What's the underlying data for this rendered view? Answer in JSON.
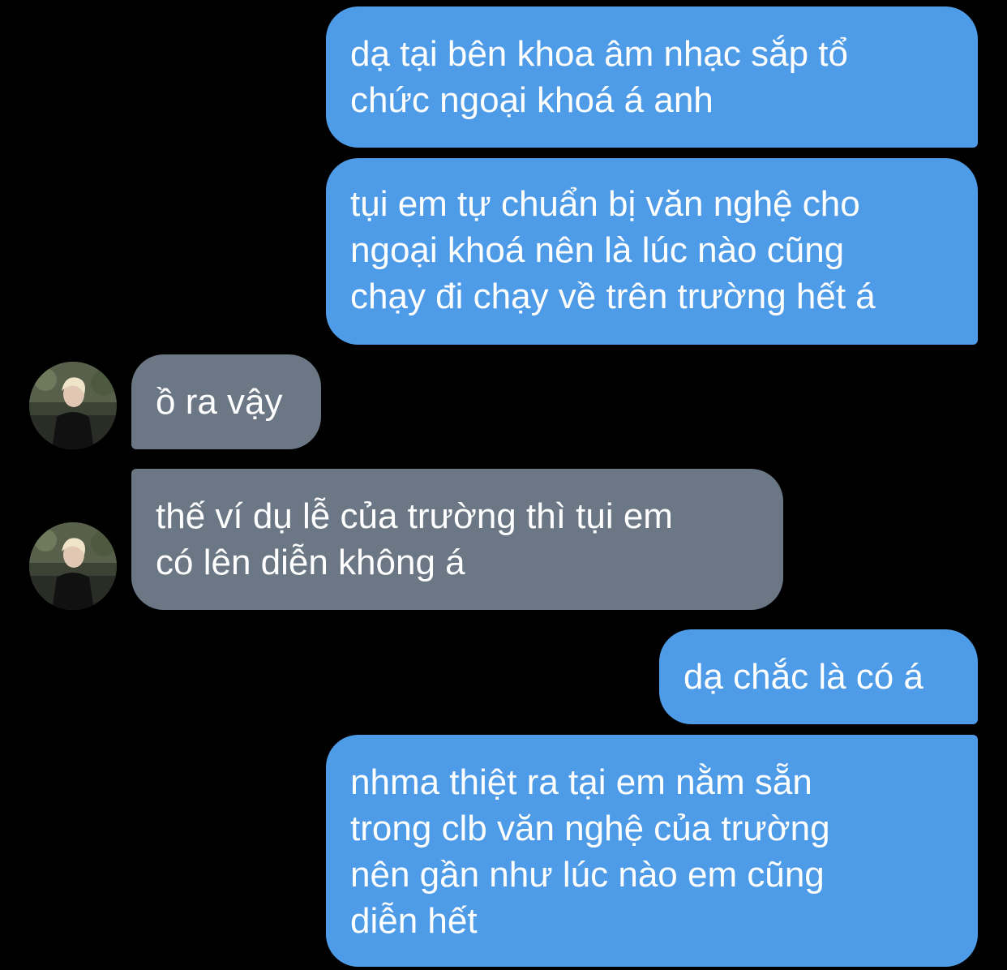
{
  "conversation": {
    "messages": [
      {
        "sender": "me",
        "text": "dạ tại bên khoa âm nhạc sắp tổ\nchức ngoại khoá á anh"
      },
      {
        "sender": "me",
        "text": "tụi em tự chuẩn bị văn nghệ cho\nngoại khoá nên là lúc nào cũng\nchạy đi chạy về trên trường hết á"
      },
      {
        "sender": "them",
        "text": "ồ ra vậy"
      },
      {
        "sender": "them",
        "text": "thế ví dụ lễ của trường thì tụi em\ncó lên diễn không á"
      },
      {
        "sender": "me",
        "text": "dạ chắc là có á"
      },
      {
        "sender": "me",
        "text": "nhma thiệt ra tại em nằm sẵn\ntrong clb văn nghệ của trường\nnên gần như lúc nào em cũng\ndiễn hết"
      }
    ]
  },
  "colors": {
    "background": "#000000",
    "outgoing_bubble": "#4e9be8",
    "incoming_bubble": "#6b7785",
    "text": "#ffffff"
  },
  "icons": {
    "avatar": "contact-avatar-photo"
  }
}
